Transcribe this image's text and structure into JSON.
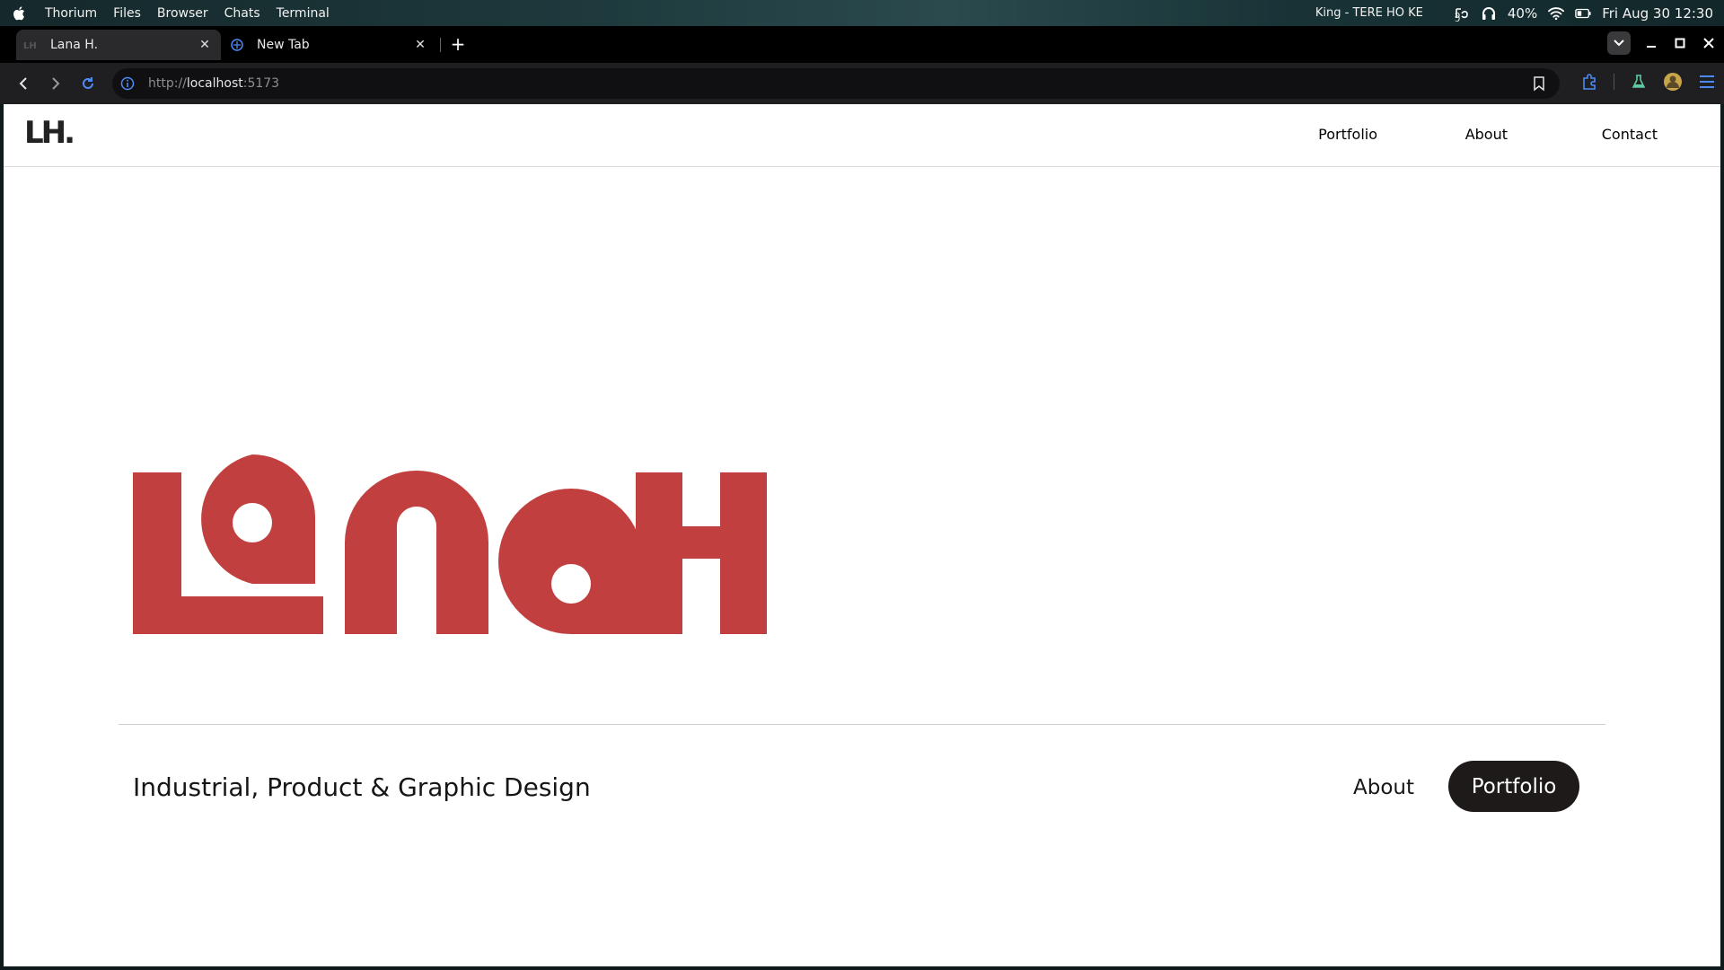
{
  "system_bar": {
    "menus": [
      "Thorium",
      "Files",
      "Browser",
      "Chats",
      "Terminal"
    ],
    "now_playing": "King - TERE HO KE",
    "battery": "40%",
    "clock": "Fri Aug 30 12:30"
  },
  "browser": {
    "tabs": [
      {
        "label": "Lana H.",
        "favicon": "lh-favicon",
        "active": true
      },
      {
        "label": "New Tab",
        "favicon": "thorium-icon",
        "active": false
      }
    ],
    "new_tab_label": "+",
    "address": {
      "scheme": "http://",
      "host": "localhost",
      "port": ":5173"
    }
  },
  "site": {
    "logo": "LH.",
    "nav": [
      "Portfolio",
      "About",
      "Contact"
    ],
    "hero_wordmark": "LaNaH",
    "brand_color": "#c1403f",
    "tagline": "Industrial, Product & Graphic Design",
    "cta_about": "About",
    "cta_portfolio": "Portfolio"
  }
}
